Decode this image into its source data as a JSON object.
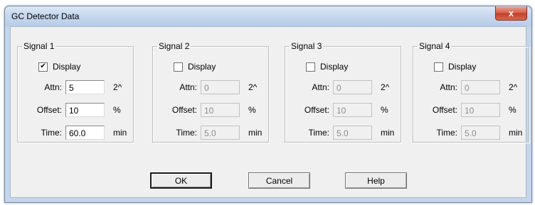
{
  "window": {
    "title": "GC Detector Data",
    "close_glyph": "x"
  },
  "signals": [
    {
      "legend": "Signal 1",
      "display_label": "Display",
      "display_checked": true,
      "enabled": true,
      "attn_label": "Attn:",
      "attn": "5",
      "attn_unit": "2^",
      "offset_label": "Offset:",
      "offset": "10",
      "offset_unit": "%",
      "time_label": "Time:",
      "time": "60.0",
      "time_unit": "min"
    },
    {
      "legend": "Signal 2",
      "display_label": "Display",
      "display_checked": false,
      "enabled": false,
      "attn_label": "Attn:",
      "attn": "0",
      "attn_unit": "2^",
      "offset_label": "Offset:",
      "offset": "10",
      "offset_unit": "%",
      "time_label": "Time:",
      "time": "5.0",
      "time_unit": "min"
    },
    {
      "legend": "Signal 3",
      "display_label": "Display",
      "display_checked": false,
      "enabled": false,
      "attn_label": "Attn:",
      "attn": "0",
      "attn_unit": "2^",
      "offset_label": "Offset:",
      "offset": "10",
      "offset_unit": "%",
      "time_label": "Time:",
      "time": "5.0",
      "time_unit": "min"
    },
    {
      "legend": "Signal 4",
      "display_label": "Display",
      "display_checked": false,
      "enabled": false,
      "attn_label": "Attn:",
      "attn": "0",
      "attn_unit": "2^",
      "offset_label": "Offset:",
      "offset": "10",
      "offset_unit": "%",
      "time_label": "Time:",
      "time": "5.0",
      "time_unit": "min"
    }
  ],
  "buttons": {
    "ok": "OK",
    "cancel": "Cancel",
    "help": "Help"
  },
  "colors": {
    "titlebar": "#c7d8ee",
    "close_button": "#c3402a",
    "dialog_face": "#f0f0f0"
  }
}
